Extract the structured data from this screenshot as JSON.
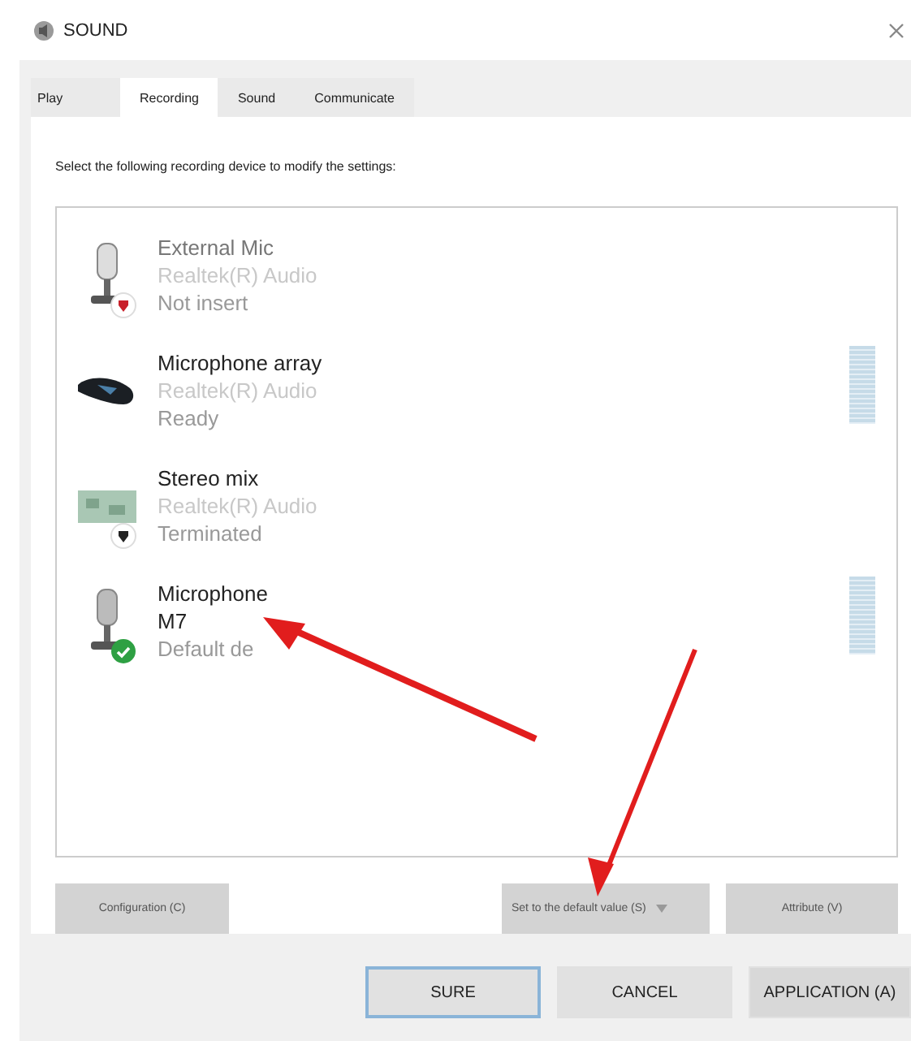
{
  "window": {
    "title": "SOUND"
  },
  "tabs": [
    {
      "label": "Play",
      "selected": false
    },
    {
      "label": "Recording",
      "selected": true
    },
    {
      "label": "Sound",
      "selected": false
    },
    {
      "label": "Communicate",
      "selected": false
    }
  ],
  "instruction": "Select the following recording device to modify the settings:",
  "devices": [
    {
      "name": "External Mic",
      "driver": "Realtek(R) Audio",
      "status": "Not insert",
      "kind": "mic-unplugged",
      "disabled": true,
      "meter": false
    },
    {
      "name": "Microphone array",
      "driver": "Realtek(R) Audio",
      "status": "Ready",
      "kind": "array",
      "disabled": false,
      "meter": true
    },
    {
      "name": "Stereo mix",
      "driver": "Realtek(R) Audio",
      "status": "Terminated",
      "kind": "mix-off",
      "disabled": false,
      "meter": false
    },
    {
      "name": "Microphone",
      "driver": "M7",
      "status": "Default de",
      "kind": "mic-default",
      "disabled": false,
      "meter": true
    }
  ],
  "device_buttons": [
    {
      "label": "Configuration (C)",
      "kind": "plain"
    },
    {
      "label": "Set to the default value (S)",
      "kind": "split"
    },
    {
      "label": "Attribute (V)",
      "kind": "plain"
    }
  ],
  "dialog_buttons": [
    {
      "label": "SURE",
      "focused": true
    },
    {
      "label": "CANCEL",
      "focused": false
    },
    {
      "label": "APPLICATION (A)",
      "focused": false
    }
  ]
}
